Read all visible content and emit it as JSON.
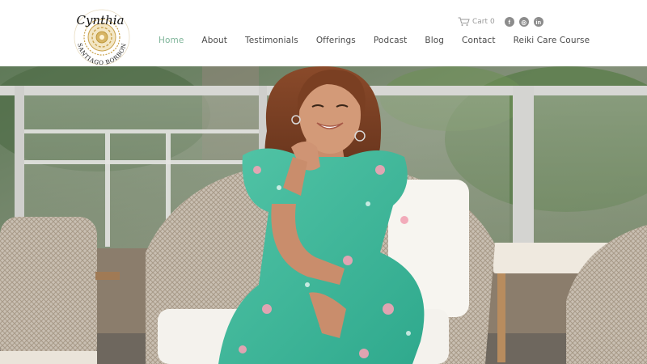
{
  "brand": {
    "name_script": "Cynthia",
    "name_caps": "SANTIAGO BORBON",
    "accent_color": "#7fb59a",
    "gold_color": "#c9a24c"
  },
  "nav": {
    "items": [
      {
        "label": "Home",
        "active": true
      },
      {
        "label": "About",
        "active": false
      },
      {
        "label": "Testimonials",
        "active": false
      },
      {
        "label": "Offerings",
        "active": false
      },
      {
        "label": "Podcast",
        "active": false
      },
      {
        "label": "Blog",
        "active": false
      },
      {
        "label": "Contact",
        "active": false
      },
      {
        "label": "Reiki Care Course",
        "active": false
      }
    ]
  },
  "utility": {
    "cart_label": "Cart",
    "cart_count": "0",
    "cart_icon": "shopping-cart-icon",
    "social": [
      {
        "name": "facebook-icon",
        "glyph": "f"
      },
      {
        "name": "instagram-icon",
        "glyph": "◎"
      },
      {
        "name": "linkedin-icon",
        "glyph": "in"
      }
    ]
  },
  "hero": {
    "image": "smiling-woman-in-teal-floral-dress-seated-in-wicker-chair-on-patio"
  }
}
